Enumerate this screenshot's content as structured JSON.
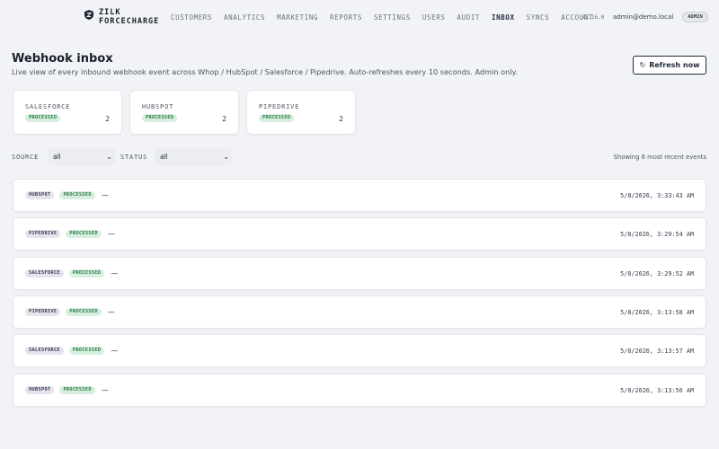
{
  "brand": {
    "line1": "ZILK",
    "line2": "FORCECHARGE"
  },
  "nav": [
    "CUSTOMERS",
    "ANALYTICS",
    "MARKETING",
    "REPORTS",
    "SETTINGS",
    "USERS",
    "AUDIT",
    "INBOX",
    "SYNCS",
    "ACCOUNT"
  ],
  "nav_active": "INBOX",
  "header": {
    "version": "v2.16.0",
    "user_email": "admin@demo.local",
    "role": "ADMIN"
  },
  "page": {
    "title": "Webhook inbox",
    "subtitle": "Live view of every inbound webhook event across Whop / HubSpot / Salesforce / Pipedrive. Auto-refreshes every 10 seconds. Admin only.",
    "refresh_label": "Refresh now",
    "refresh_icon": "refresh-icon ↻"
  },
  "summary_cards": [
    {
      "source": "SALESFORCE",
      "status": "PROCESSED",
      "count": "2"
    },
    {
      "source": "HUBSPOT",
      "status": "PROCESSED",
      "count": "2"
    },
    {
      "source": "PIPEDRIVE",
      "status": "PROCESSED",
      "count": "2"
    }
  ],
  "filters": {
    "source_label": "SOURCE",
    "source_value": "all",
    "status_label": "STATUS",
    "status_value": "all",
    "showing": "Showing 6 most recent events"
  },
  "events": [
    {
      "source": "HUBSPOT",
      "status": "PROCESSED",
      "detail": "—",
      "timestamp": "5/8/2026, 3:33:43 AM"
    },
    {
      "source": "PIPEDRIVE",
      "status": "PROCESSED",
      "detail": "—",
      "timestamp": "5/8/2026, 3:29:54 AM"
    },
    {
      "source": "SALESFORCE",
      "status": "PROCESSED",
      "detail": "—",
      "timestamp": "5/8/2026, 3:29:52 AM"
    },
    {
      "source": "PIPEDRIVE",
      "status": "PROCESSED",
      "detail": "—",
      "timestamp": "5/8/2026, 3:13:58 AM"
    },
    {
      "source": "SALESFORCE",
      "status": "PROCESSED",
      "detail": "—",
      "timestamp": "5/8/2026, 3:13:57 AM"
    },
    {
      "source": "HUBSPOT",
      "status": "PROCESSED",
      "detail": "—",
      "timestamp": "5/8/2026, 3:13:56 AM"
    }
  ],
  "colors": {
    "accent": "#1f2937",
    "status_bg": "#d6efdf",
    "status_fg": "#2d7a48",
    "source_bg": "#e6e3ee",
    "page_bg": "#f1f3f7"
  }
}
